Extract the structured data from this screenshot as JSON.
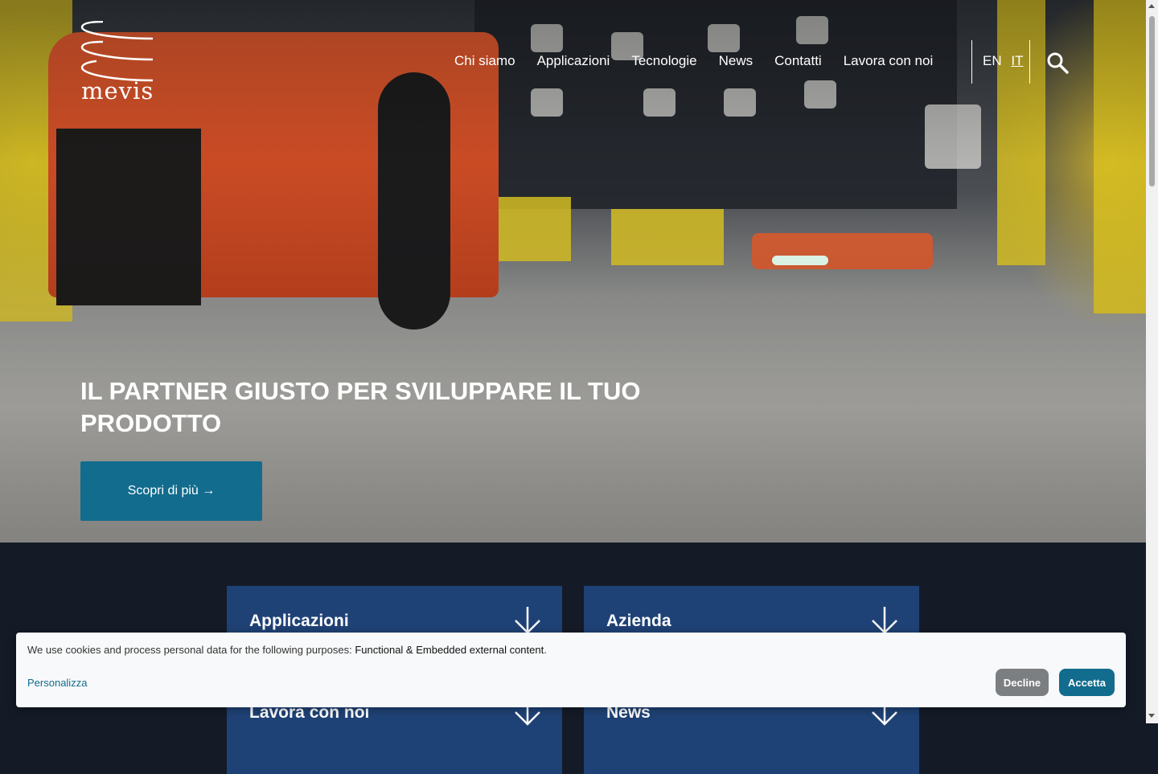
{
  "logo": {
    "text": "mevis"
  },
  "nav": {
    "items": [
      "Chi siamo",
      "Applicazioni",
      "Tecnologie",
      "News",
      "Contatti",
      "Lavora con noi"
    ]
  },
  "language": {
    "en": "EN",
    "it": "IT",
    "active": "IT"
  },
  "hero": {
    "headline": "IL PARTNER GIUSTO PER SVILUPPARE IL TUO PRODOTTO",
    "cta": "Scopri di più →"
  },
  "cards": [
    "Applicazioni",
    "Azienda",
    "Lavora con noi",
    "News"
  ],
  "cookie": {
    "text": "We use cookies and process personal data for the following purposes: ",
    "purposes": "Functional & Embedded external content",
    "period": ".",
    "customize": "Personalizza",
    "decline": "Decline",
    "accept": "Accetta"
  },
  "colors": {
    "primary": "#126c8e",
    "card": "#1f4276",
    "dark_bg": "#141b27"
  }
}
